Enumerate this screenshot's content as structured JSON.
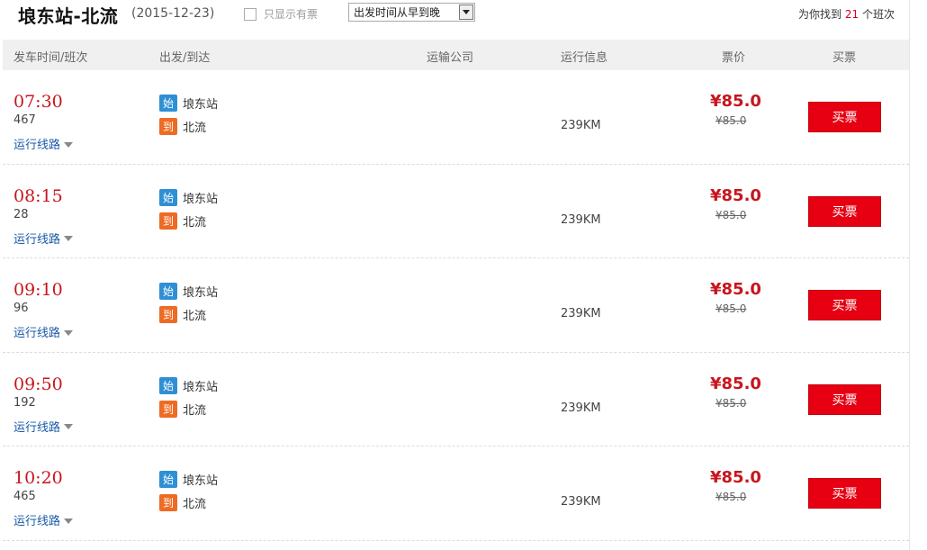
{
  "header": {
    "route": "埌东站-北流",
    "date": "(2015-12-23)",
    "only_available_label": "只显示有票",
    "sort_value": "出发时间从早到晚",
    "found_prefix": "为你找到",
    "found_count": "21",
    "found_suffix": "个班次"
  },
  "columns": {
    "time": "发车时间/班次",
    "station": "出发/到达",
    "company": "运输公司",
    "info": "运行信息",
    "price": "票价",
    "buy": "买票"
  },
  "labels": {
    "start_tag": "始",
    "end_tag": "到",
    "route_link": "运行线路",
    "buy_button": "买票"
  },
  "trips": [
    {
      "time": "07:30",
      "number": "467",
      "from": "埌东站",
      "to": "北流",
      "distance": "239KM",
      "price": "¥85.0",
      "orig_price": "¥85.0"
    },
    {
      "time": "08:15",
      "number": "28",
      "from": "埌东站",
      "to": "北流",
      "distance": "239KM",
      "price": "¥85.0",
      "orig_price": "¥85.0"
    },
    {
      "time": "09:10",
      "number": "96",
      "from": "埌东站",
      "to": "北流",
      "distance": "239KM",
      "price": "¥85.0",
      "orig_price": "¥85.0"
    },
    {
      "time": "09:50",
      "number": "192",
      "from": "埌东站",
      "to": "北流",
      "distance": "239KM",
      "price": "¥85.0",
      "orig_price": "¥85.0"
    },
    {
      "time": "10:20",
      "number": "465",
      "from": "埌东站",
      "to": "北流",
      "distance": "239KM",
      "price": "¥85.0",
      "orig_price": "¥85.0"
    }
  ],
  "colors": {
    "accent_red": "#e60012",
    "time_red": "#c8151d",
    "start_tag_blue": "#2f8fd5",
    "end_tag_orange": "#ee6b24",
    "link_blue": "#1a5aa8"
  }
}
